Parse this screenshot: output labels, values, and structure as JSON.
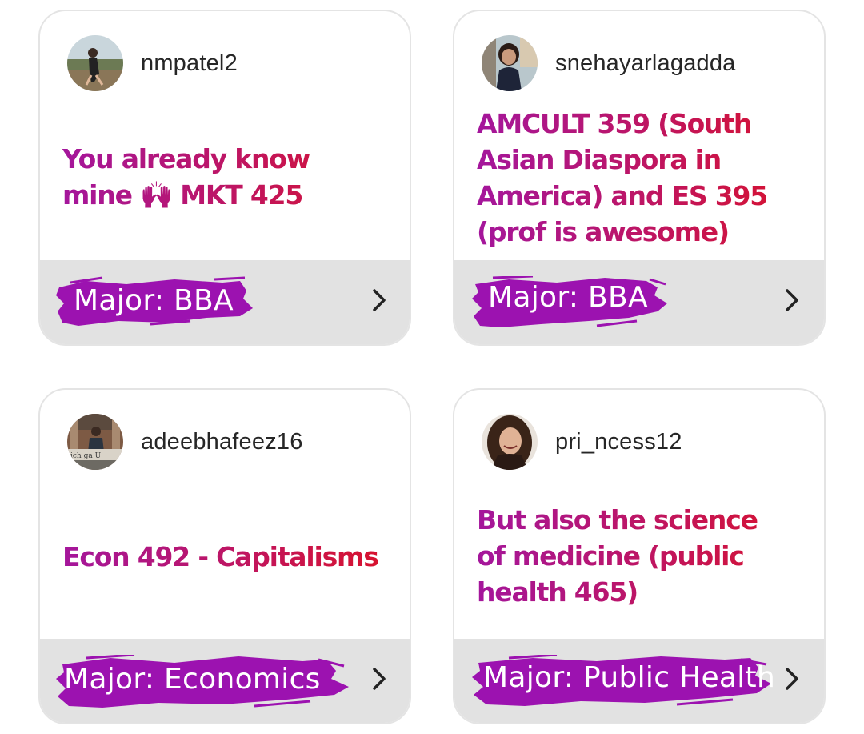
{
  "posts": [
    {
      "username": "nmpatel2",
      "text": "You already know\nmine 🙌 MKT 425",
      "major": "Major: BBA",
      "avatar_icon": "profile-photo"
    },
    {
      "username": "snehayarlagadda",
      "text": "AMCULT 359 (South\nAsian Diaspora in\nAmerica) and ES 395\n(prof is awesome)",
      "major": "Major: BBA",
      "avatar_icon": "profile-photo"
    },
    {
      "username": "adeebhafeez16",
      "text": "Econ 492 - Capitalisms",
      "major": "Major: Economics",
      "avatar_icon": "profile-photo",
      "avatar_caption": "ich ga U"
    },
    {
      "username": "pri_ncess12",
      "text": "But also the science\nof medicine (public\nhealth 465)",
      "major": "Major: Public Health",
      "avatar_icon": "profile-photo"
    }
  ],
  "colors": {
    "text_gradient_start": "#a4169c",
    "text_gradient_end": "#d9122b",
    "brush": "#9c12b0",
    "footer": "#e2e2e2"
  },
  "icons": {
    "chevron": "chevron-right-icon"
  }
}
